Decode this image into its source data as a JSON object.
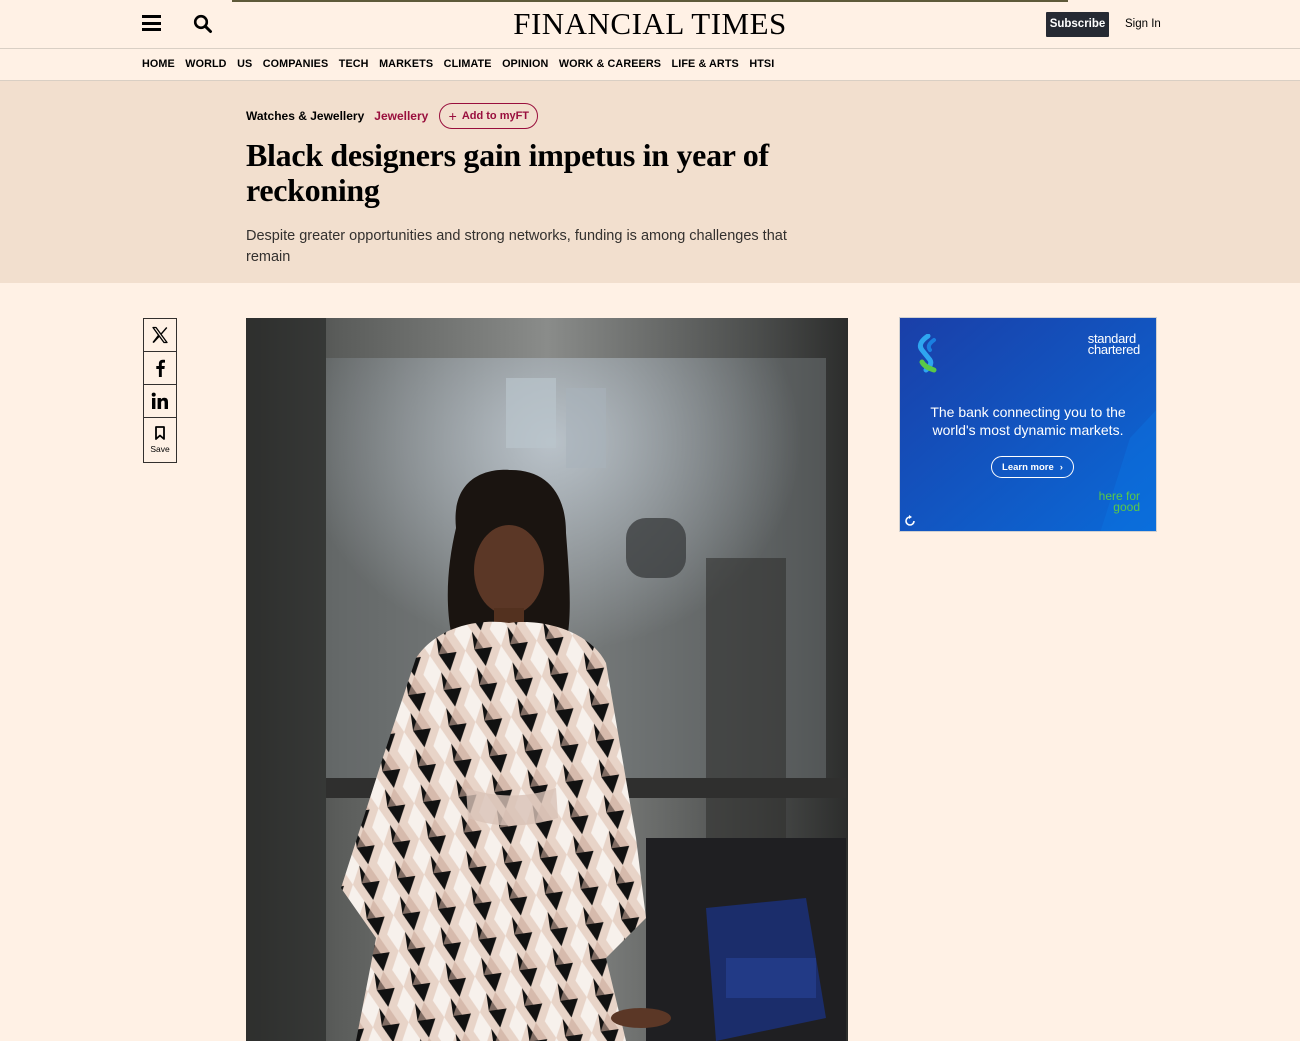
{
  "header": {
    "masthead": "FINANCIAL TIMES",
    "subscribe_label": "Subscribe",
    "signin_label": "Sign In"
  },
  "nav": {
    "items": [
      "HOME",
      "WORLD",
      "US",
      "COMPANIES",
      "TECH",
      "MARKETS",
      "CLIMATE",
      "OPINION",
      "WORK & CAREERS",
      "LIFE & ARTS",
      "HTSI"
    ]
  },
  "article": {
    "section": "Watches & Jewellery",
    "topic": "Jewellery",
    "myft_label": "Add to myFT",
    "headline": "Black designers gain impetus in year of reckoning",
    "standfirst": "Despite greater opportunities and strong networks, funding is among challenges that remain"
  },
  "share": {
    "save_label": "Save",
    "icons": [
      "x-icon",
      "facebook-icon",
      "linkedin-icon",
      "bookmark-icon"
    ]
  },
  "ad": {
    "brand_line1": "standard",
    "brand_line2": "chartered",
    "message": "The bank connecting you to the world's most dynamic markets.",
    "cta_label": "Learn more",
    "tagline_line1": "here for",
    "tagline_line2": "good",
    "colors": {
      "background_start": "#1a3fa8",
      "background_end": "#0a6ad8",
      "green": "#5ac847"
    }
  },
  "colors": {
    "page_bg": "#fff1e5",
    "hero_bg": "#f2dfce",
    "claret": "#990f3d",
    "subscribe_bg": "#262a33"
  }
}
